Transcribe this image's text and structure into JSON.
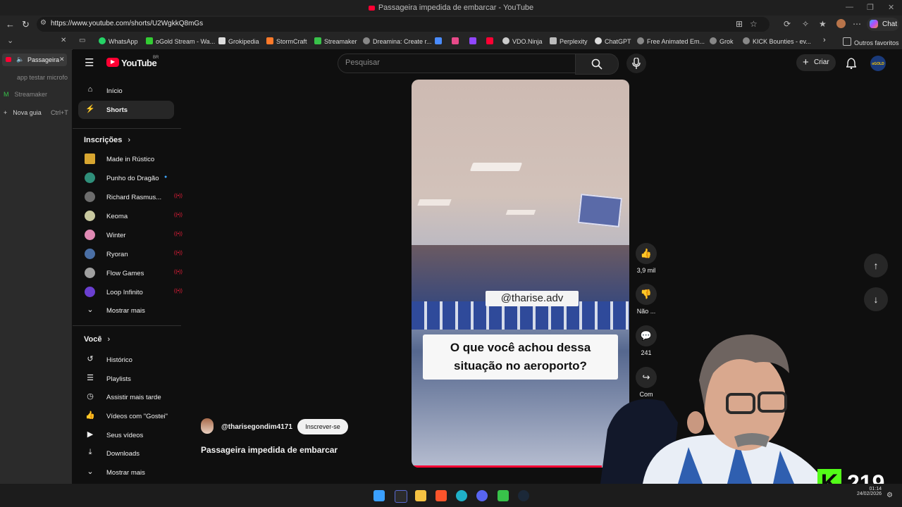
{
  "browser": {
    "window_title": "Passageira impedida de embarcar - YouTube",
    "url": "https://www.youtube.com/shorts/U2WgkkQ8mGs",
    "chat_label": "Chat",
    "bookmarks": [
      "WhatsApp",
      "oGold Stream - Wa...",
      "Grokipedia",
      "StormCraft",
      "Streamaker",
      "Dreamina: Create r...",
      "VDO.Ninja",
      "Perplexity",
      "ChatGPT",
      "Free Animated Em...",
      "Grok",
      "KICK Bounties - ev..."
    ],
    "other_favorites": "Outros favoritos",
    "vertical_tabs": {
      "active_tab": "Passageira",
      "tab2": "app testar microfo",
      "tab3": "Streamaker",
      "new_tab": "Nova guia",
      "new_tab_shortcut": "Ctrl+T"
    }
  },
  "youtube": {
    "logo_text": "YouTube",
    "logo_region": "BR",
    "search_placeholder": "Pesquisar",
    "create_label": "Criar",
    "profile_badge": "oGOLD",
    "nav": [
      {
        "label": "Início",
        "icon": "home-icon"
      },
      {
        "label": "Shorts",
        "icon": "shorts-icon"
      }
    ],
    "subscriptions_heading": "Inscrições",
    "subscriptions": [
      {
        "label": "Made in Rústico",
        "avatar_color": "#d8a630",
        "status": ""
      },
      {
        "label": "Punho do Dragão",
        "avatar_color": "#2f8f7a",
        "status": "dot"
      },
      {
        "label": "Richard Rasmus...",
        "avatar_color": "#6d6d6d",
        "status": "live"
      },
      {
        "label": "Keoma",
        "avatar_color": "#c9c9a0",
        "status": "live"
      },
      {
        "label": "Winter",
        "avatar_color": "#e08ab4",
        "status": "live"
      },
      {
        "label": "Ryoran",
        "avatar_color": "#4a6fa5",
        "status": "live"
      },
      {
        "label": "Flow Games",
        "avatar_color": "#a0a0a0",
        "status": "live"
      },
      {
        "label": "Loop Infinito",
        "avatar_color": "#6a3fd0",
        "status": "live"
      }
    ],
    "show_more_1": "Mostrar mais",
    "you_heading": "Você",
    "you_items": [
      {
        "label": "Histórico",
        "icon": "history-icon"
      },
      {
        "label": "Playlists",
        "icon": "playlists-icon"
      },
      {
        "label": "Assistir mais tarde",
        "icon": "watch-later-icon"
      },
      {
        "label": "Vídeos com \"Gostei\"",
        "icon": "liked-videos-icon"
      },
      {
        "label": "Seus vídeos",
        "icon": "your-videos-icon"
      },
      {
        "label": "Downloads",
        "icon": "downloads-icon"
      }
    ],
    "show_more_2": "Mostrar mais",
    "short": {
      "channel": "@tharisegondim4171",
      "subscribe": "Inscrever-se",
      "title": "Passageira impedida de embarcar",
      "overlay_handle": "@tharise.adv",
      "overlay_caption_line1": "O que você achou dessa",
      "overlay_caption_line2": "situação no aeroporto?",
      "likes": "3,9 mil",
      "dislike_label": "Não ...",
      "comments": "241",
      "share_label": "Com"
    }
  },
  "stream_overlay": {
    "viewer_count": "219",
    "badge_letter": "K"
  },
  "system": {
    "time": "01:14",
    "date": "24/02/2026"
  }
}
